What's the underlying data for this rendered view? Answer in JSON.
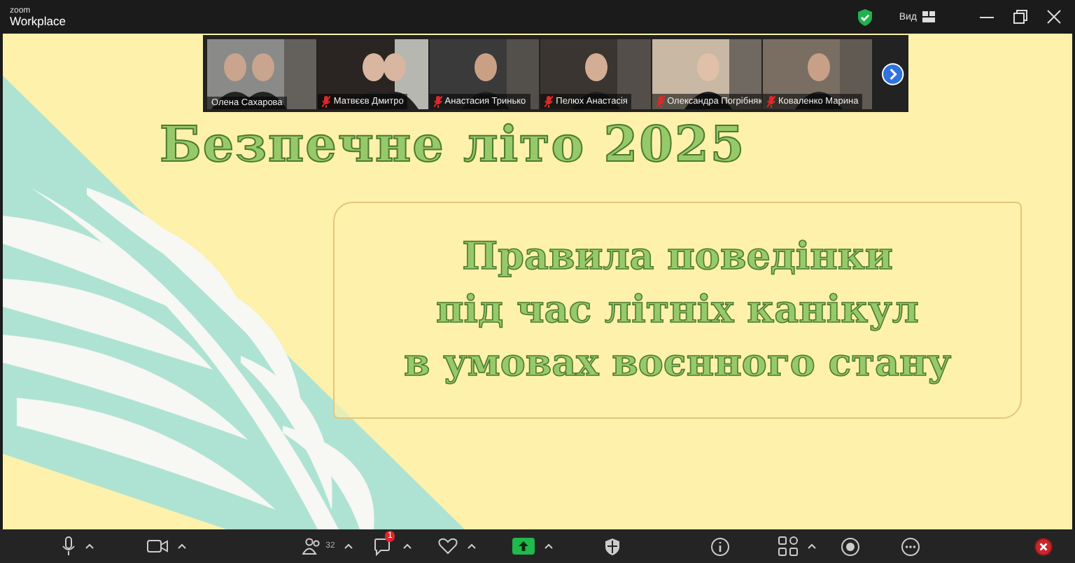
{
  "app": {
    "brand_top": "zoom",
    "brand_bottom": "Workplace",
    "view_label": "Вид"
  },
  "participants": [
    {
      "name": "Олена Сахарова",
      "muted": false
    },
    {
      "name": "Матвєєв Дмитро",
      "muted": true
    },
    {
      "name": "Анастасия Тринько",
      "muted": true
    },
    {
      "name": "Пелюх Анастасія",
      "muted": true
    },
    {
      "name": "Олександра Погрібняк",
      "muted": true
    },
    {
      "name": "Коваленко Марина",
      "muted": true
    }
  ],
  "slide": {
    "title": "Безпечне літо 2025",
    "subtitle_lines": [
      "Правила поведінки",
      "під час літніх канікул",
      "в умовах воєнного стану"
    ]
  },
  "toolbar": [
    {
      "kind": "mic",
      "caret": true
    },
    {
      "kind": "camera",
      "caret": true
    },
    {
      "kind": "participants",
      "count": "32",
      "caret": true
    },
    {
      "kind": "chat",
      "badge": "1",
      "caret": true
    },
    {
      "kind": "react",
      "caret": true
    },
    {
      "kind": "share",
      "caret": true
    },
    {
      "kind": "security",
      "caret": false
    },
    {
      "kind": "info",
      "caret": false
    },
    {
      "kind": "apps",
      "caret": true
    },
    {
      "kind": "record",
      "caret": false
    },
    {
      "kind": "more",
      "caret": false
    },
    {
      "kind": "end",
      "caret": false
    }
  ]
}
